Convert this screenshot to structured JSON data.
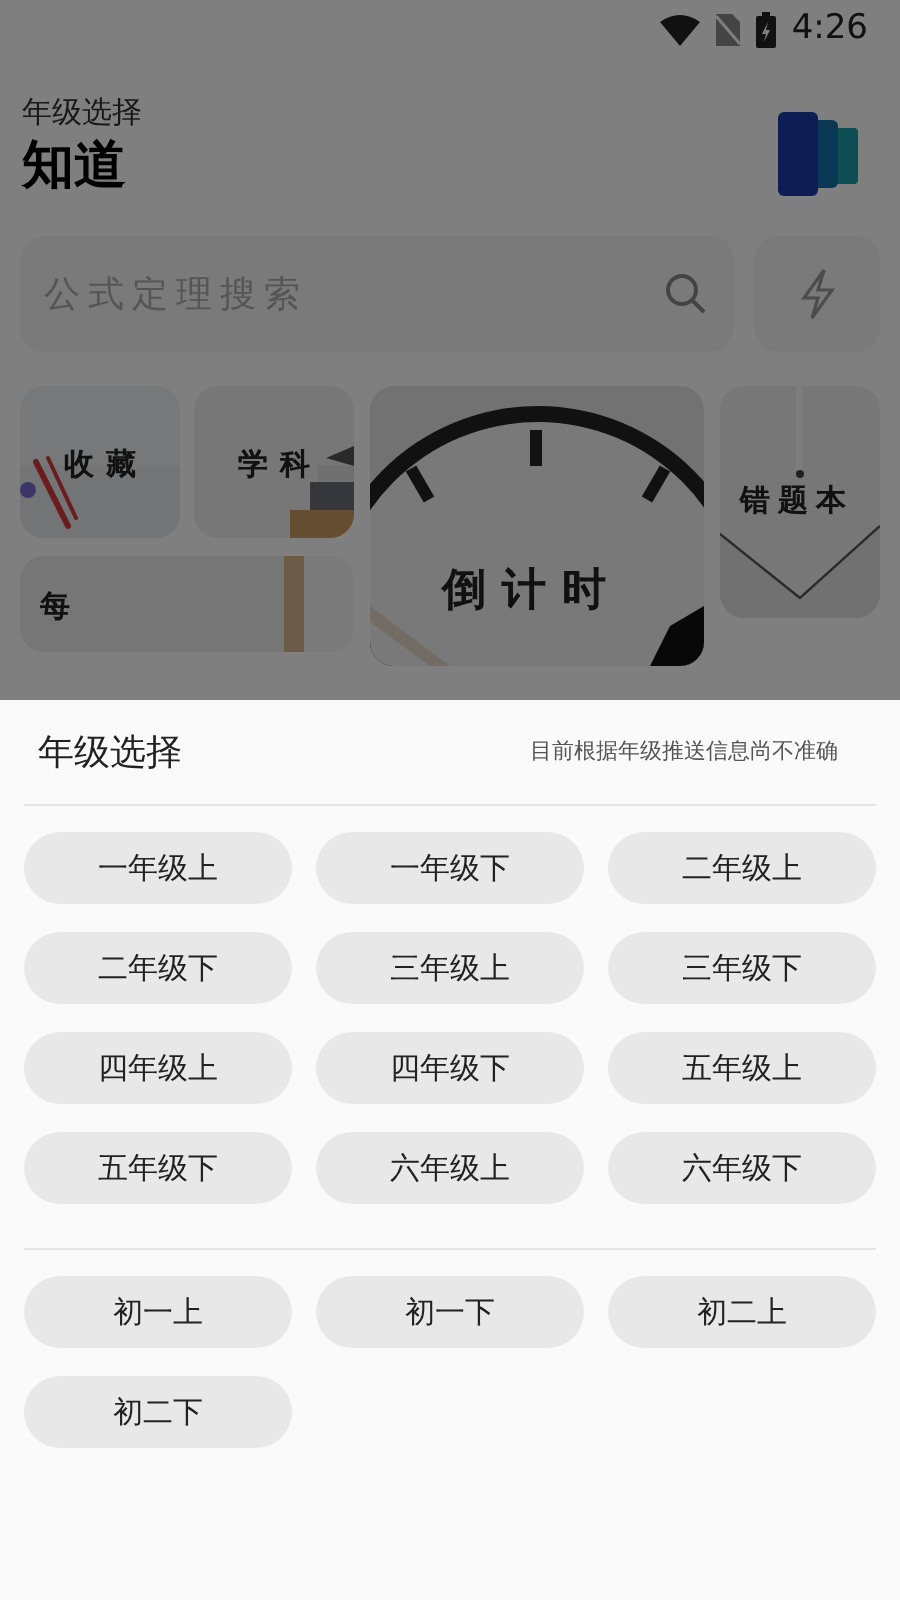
{
  "status_bar": {
    "time": "4:26"
  },
  "header": {
    "subtitle": "年级选择",
    "title": "知道"
  },
  "search": {
    "placeholder": "公式定理搜索"
  },
  "tiles": [
    {
      "kind": "clip",
      "label": "收藏"
    },
    {
      "kind": "books",
      "label": "学科"
    },
    {
      "kind": "clock",
      "label": "倒计时"
    },
    {
      "kind": "paper",
      "label": "错题本"
    },
    {
      "kind": "desk",
      "label": "每"
    }
  ],
  "sheet": {
    "title": "年级选择",
    "hint": "目前根据年级推送信息尚不准确",
    "groups": [
      {
        "options": [
          {
            "label": "一年级上"
          },
          {
            "label": "一年级下"
          },
          {
            "label": "二年级上"
          },
          {
            "label": "二年级下"
          },
          {
            "label": "三年级上"
          },
          {
            "label": "三年级下"
          },
          {
            "label": "四年级上"
          },
          {
            "label": "四年级下"
          },
          {
            "label": "五年级上"
          },
          {
            "label": "五年级下"
          },
          {
            "label": "六年级上"
          },
          {
            "label": "六年级下"
          }
        ]
      },
      {
        "options": [
          {
            "label": "初一上"
          },
          {
            "label": "初一下"
          },
          {
            "label": "初二上"
          },
          {
            "label": "初二下"
          }
        ]
      }
    ]
  }
}
